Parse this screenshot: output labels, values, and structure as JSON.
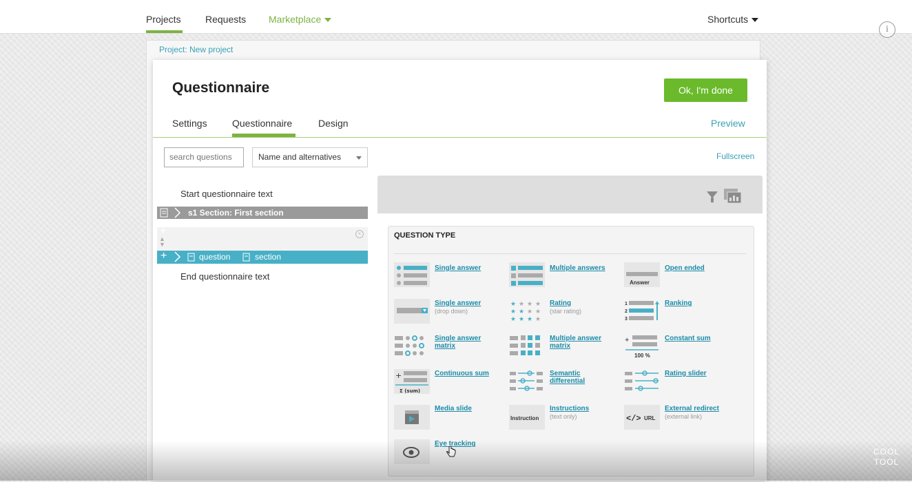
{
  "nav": {
    "projects": "Projects",
    "requests": "Requests",
    "marketplace": "Marketplace",
    "shortcuts": "Shortcuts"
  },
  "breadcrumb": "Project: New project",
  "title": "Questionnaire",
  "ok_button": "Ok, I'm done",
  "tabs": {
    "settings": "Settings",
    "questionnaire": "Questionnaire",
    "design": "Design"
  },
  "preview": "Preview",
  "search": {
    "placeholder": "search questions",
    "select_value": "Name and alternatives"
  },
  "fullscreen": "Fullscreen",
  "tree": {
    "start_text": "Start questionnaire text",
    "section_label": "s1 Section:  First section",
    "add_question": "question",
    "add_section": "section",
    "end_text": "End questionnaire text"
  },
  "question_type": {
    "title": "QUESTION TYPE",
    "items": [
      {
        "label": "Single answer",
        "sub": ""
      },
      {
        "label": "Multiple answers",
        "sub": ""
      },
      {
        "label": "Open ended",
        "sub": "",
        "icon_text": "Answer"
      },
      {
        "label": "Single answer",
        "sub": "(drop down)"
      },
      {
        "label": "Rating",
        "sub": "(star rating)"
      },
      {
        "label": "Ranking",
        "sub": ""
      },
      {
        "label": "Single answer matrix",
        "sub": ""
      },
      {
        "label": "Multiple answer matrix",
        "sub": ""
      },
      {
        "label": "Constant sum",
        "sub": "",
        "icon_text": "100 %"
      },
      {
        "label": "Continuous sum",
        "sub": "",
        "icon_text": "Σ (sum)"
      },
      {
        "label": "Semantic differential",
        "sub": ""
      },
      {
        "label": "Rating slider",
        "sub": ""
      },
      {
        "label": "Media slide",
        "sub": ""
      },
      {
        "label": "Instructions",
        "sub": "(text only)",
        "icon_text": "Instruction"
      },
      {
        "label": "External redirect",
        "sub": "(external link)",
        "icon_text": "URL"
      },
      {
        "label": "Eye tracking",
        "sub": ""
      }
    ]
  },
  "logo": {
    "line1": "COOL",
    "line2": "TOOL"
  },
  "colors": {
    "green": "#6aba2b",
    "teal": "#48b0c6",
    "link": "#1b8ba8"
  }
}
